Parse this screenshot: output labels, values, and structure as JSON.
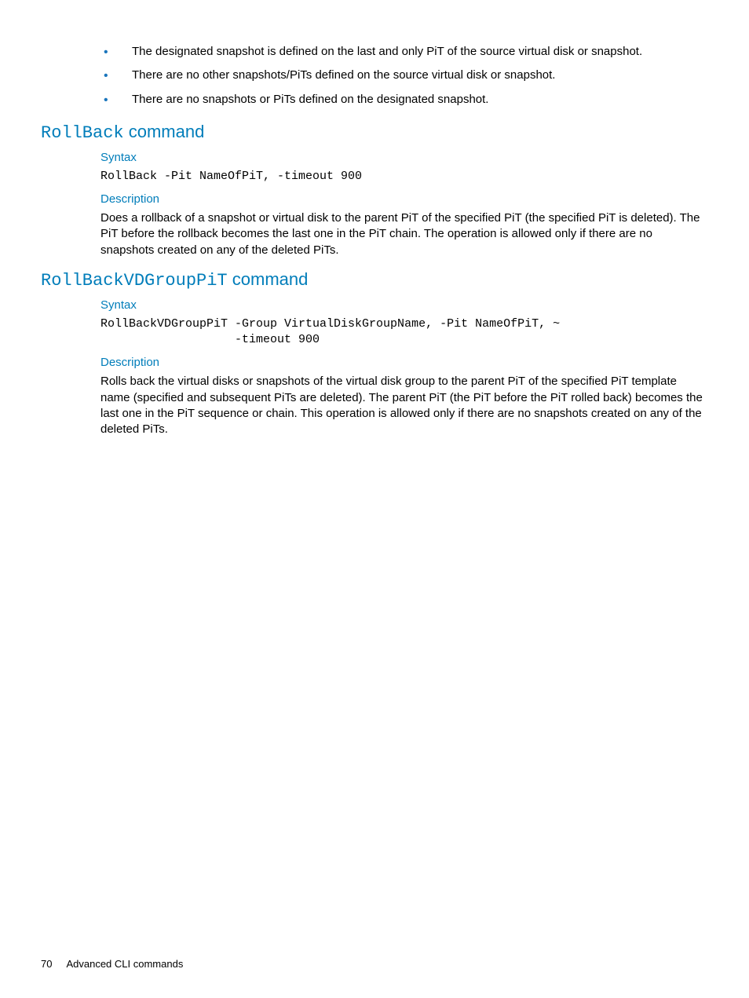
{
  "bullets": [
    "The designated snapshot is defined on the last and only PiT of the source virtual disk or snapshot.",
    "There are no other snapshots/PiTs defined on the source virtual disk or snapshot.",
    "There are no snapshots or PiTs defined on the designated snapshot."
  ],
  "section1": {
    "heading_mono": "RollBack",
    "heading_rest": " command",
    "syntax_label": "Syntax",
    "syntax_code": "RollBack -Pit NameOfPiT, -timeout 900",
    "description_label": "Description",
    "description_text": "Does a rollback of a snapshot or virtual disk to the parent PiT of the specified PiT (the specified PiT is deleted). The PiT before the rollback becomes the last one in the PiT chain. The operation is allowed only if there are no snapshots created on any of the deleted PiTs."
  },
  "section2": {
    "heading_mono": "RollBackVDGroupPiT",
    "heading_rest": " command",
    "syntax_label": "Syntax",
    "syntax_code": "RollBackVDGroupPiT -Group VirtualDiskGroupName, -Pit NameOfPiT, ~\n                   -timeout 900",
    "description_label": "Description",
    "description_text": "Rolls back the virtual disks or snapshots of the virtual disk group to the parent PiT of the specified PiT template name (specified and subsequent PiTs are deleted). The parent PiT (the PiT before the PiT rolled back) becomes the last one in the PiT sequence or chain. This operation is allowed only if there are no snapshots created on any of the deleted PiTs."
  },
  "footer": {
    "page_number": "70",
    "section_name": "Advanced CLI commands"
  }
}
